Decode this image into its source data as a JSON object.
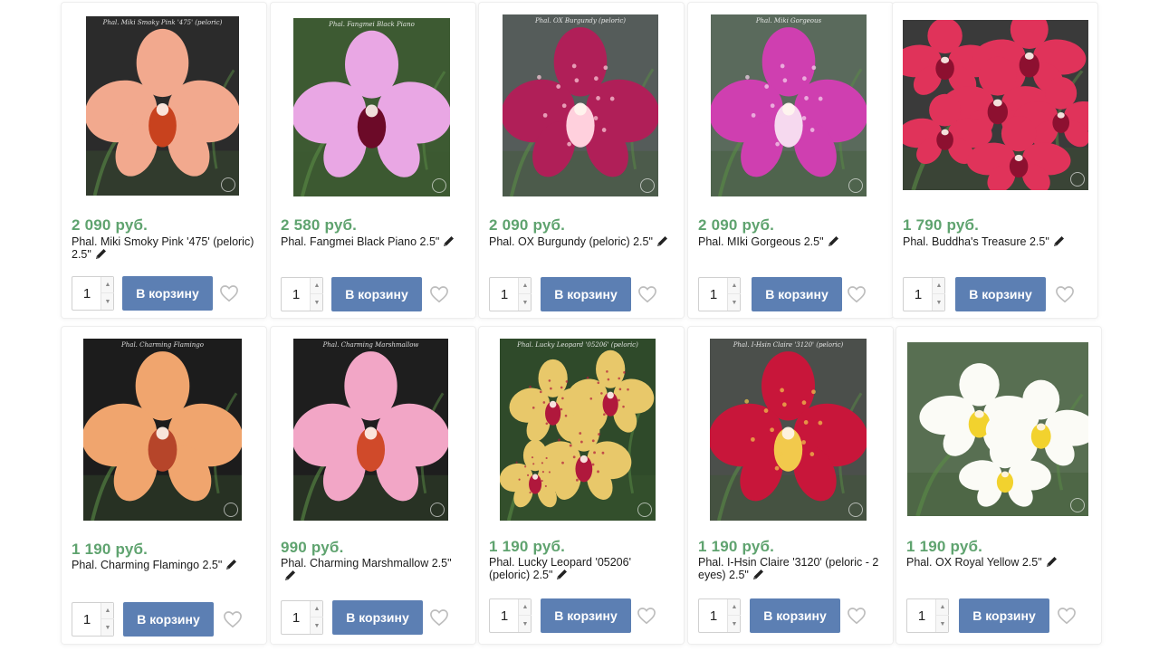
{
  "currency_suffix": "руб.",
  "cart_button_label": "В корзину",
  "colors": {
    "price": "#5fa36f",
    "cart_button": "#5c7fb3",
    "heart_outline": "#bdbdbd"
  },
  "products": [
    {
      "price": "2 090 руб.",
      "name": "Phal. Miki Smoky Pink '475' (peloric) 2.5\"",
      "qty": "1",
      "photo_caption": "Phal. Miki Smoky Pink '475' (peloric)",
      "flower_color": "#f2a98e",
      "flower_accent": "#c8421e",
      "photo_bg": "#2b2b2b"
    },
    {
      "price": "2 580 руб.",
      "name": "Phal. Fangmei Black Piano 2.5\"",
      "qty": "1",
      "photo_caption": "Phal. Fangmei Black Piano",
      "flower_color": "#e9a7e4",
      "flower_accent": "#6c0a28",
      "photo_bg": "#3d5a32"
    },
    {
      "price": "2 090 руб.",
      "name": "Phal. OX Burgundy (peloric) 2.5\"",
      "qty": "1",
      "photo_caption": "Phal. OX Burgundy (peloric)",
      "flower_color": "#b01f58",
      "flower_accent": "#ffd0dd",
      "photo_bg": "#555c5a"
    },
    {
      "price": "2 090 руб.",
      "name": "Phal. MIki Gorgeous 2.5\"",
      "qty": "1",
      "photo_caption": "Phal. Miki Gorgeous",
      "flower_color": "#cf3fb0",
      "flower_accent": "#f6d9ef",
      "photo_bg": "#5a6a5c"
    },
    {
      "price": "1 790 руб.",
      "name": "Phal. Buddha's Treasure 2.5\"",
      "qty": "1",
      "photo_caption": "",
      "flower_color": "#e0335a",
      "flower_accent": "#8d1030",
      "photo_bg": "#3a3a3a"
    },
    {
      "price": "1 190 руб.",
      "name": "Phal. Charming Flamingo 2.5\"",
      "qty": "1",
      "photo_caption": "Phal. Charming Flamingo",
      "flower_color": "#f0a56e",
      "flower_accent": "#b6452a",
      "photo_bg": "#1c1c1c"
    },
    {
      "price": "990 руб.",
      "name": "Phal. Charming Marshmallow 2.5\"",
      "qty": "1",
      "photo_caption": "Phal. Charming Marshmallow",
      "flower_color": "#f2a6c6",
      "flower_accent": "#d04a2a",
      "photo_bg": "#1e1e1e"
    },
    {
      "price": "1 190 руб.",
      "name": "Phal. Lucky Leopard '05206' (peloric) 2.5\"",
      "qty": "1",
      "photo_caption": "Phal. Lucky Leopard '05206' (peloric)",
      "flower_color": "#e8c86a",
      "flower_accent": "#b0183c",
      "photo_bg": "#2f4a2a"
    },
    {
      "price": "1 190 руб.",
      "name": "Phal. I-Hsin Claire '3120' (peloric - 2 eyes) 2.5\"",
      "qty": "1",
      "photo_caption": "Phal. I-Hsin Claire '3120' (peloric)",
      "flower_color": "#c8163a",
      "flower_accent": "#f2c94c",
      "photo_bg": "#4b4f4b"
    },
    {
      "price": "1 190 руб.",
      "name": "Phal. OX Royal Yellow 2.5\"",
      "qty": "1",
      "photo_caption": "",
      "flower_color": "#fbfbf6",
      "flower_accent": "#f2d22e",
      "photo_bg": "#586f52"
    }
  ]
}
